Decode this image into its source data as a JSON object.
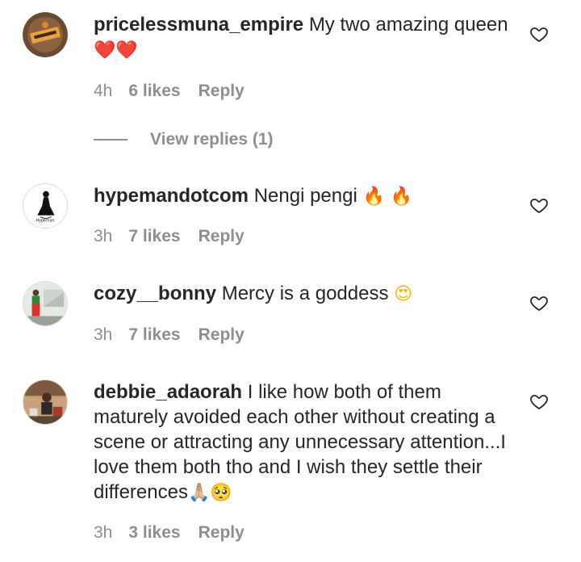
{
  "comments": [
    {
      "username": "pricelessmuna_empire",
      "text": "My two amazing queen",
      "emoji": "❤️❤️",
      "time": "4h",
      "likes": "6 likes",
      "reply": "Reply",
      "avatar_icon": "brand-logo-avatar"
    },
    {
      "username": "hypemandotcom",
      "text": "Nengi pengi",
      "emoji": "🔥 🔥",
      "time": "3h",
      "likes": "7 likes",
      "reply": "Reply",
      "avatar_icon": "silhouette-logo-avatar",
      "avatar_text": "Hypeman"
    },
    {
      "username": "cozy__bonny",
      "text": "Mercy is a goddess",
      "emoji": "😍",
      "time": "3h",
      "likes": "7 likes",
      "reply": "Reply",
      "avatar_icon": "photo-avatar"
    },
    {
      "username": "debbie_adaorah",
      "text": "I like how both of them maturely avoided each other without creating a scene or attracting any unnecessary attention...I love them both tho and I wish they settle their differences",
      "emoji": "🙏🏼🥺",
      "time": "3h",
      "likes": "3 likes",
      "reply": "Reply",
      "avatar_icon": "photo-avatar"
    }
  ],
  "view_replies": "View replies (1)",
  "colors": {
    "text": "#262626",
    "secondary": "#8e8e8e",
    "background": "#ffffff"
  }
}
